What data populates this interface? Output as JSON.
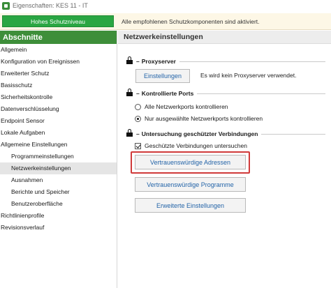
{
  "window": {
    "title": "Eigenschaften: KES 11 - IT"
  },
  "status": {
    "badge": "Hohes Schutzniveau",
    "message": "Alle empfohlenen Schutzkomponenten sind aktiviert."
  },
  "sidebar": {
    "header": "Abschnitte",
    "items": [
      {
        "label": "Allgemein"
      },
      {
        "label": "Konfiguration von Ereignissen"
      },
      {
        "label": "Erweiterter Schutz"
      },
      {
        "label": "Basisschutz"
      },
      {
        "label": "Sicherheitskontrolle"
      },
      {
        "label": "Datenverschlüsselung"
      },
      {
        "label": "Endpoint Sensor"
      },
      {
        "label": "Lokale Aufgaben"
      },
      {
        "label": "Allgemeine Einstellungen"
      },
      {
        "label": "Programmeinstellungen"
      },
      {
        "label": "Netzwerkeinstellungen"
      },
      {
        "label": "Ausnahmen"
      },
      {
        "label": "Berichte und Speicher"
      },
      {
        "label": "Benutzeroberfläche"
      },
      {
        "label": "Richtlinienprofile"
      },
      {
        "label": "Revisionsverlauf"
      }
    ]
  },
  "main": {
    "title": "Netzwerkeinstellungen",
    "proxy": {
      "heading": "Proxyserver",
      "button": "Einstellungen",
      "note": "Es wird kein Proxyserver verwendet."
    },
    "ports": {
      "heading": "Kontrollierte Ports",
      "option_all": "Alle Netzwerkports kontrollieren",
      "option_selected": "Nur ausgewählte Netzwerkports kontrollieren",
      "selected": "option_selected"
    },
    "scan": {
      "heading": "Untersuchung geschützter Verbindungen",
      "checkbox": "Geschützte Verbindungen untersuchen",
      "checked": true,
      "button_trusted_addresses": "Vertrauenswürdige Adressen",
      "button_trusted_programs": "Vertrauenswürdige Programme",
      "button_advanced": "Erweiterte Einstellungen"
    }
  },
  "colors": {
    "status_badge": "#2aa642",
    "sidebar_header": "#3e8e3a",
    "link_text": "#2464a8",
    "highlight": "#d03a3a"
  }
}
